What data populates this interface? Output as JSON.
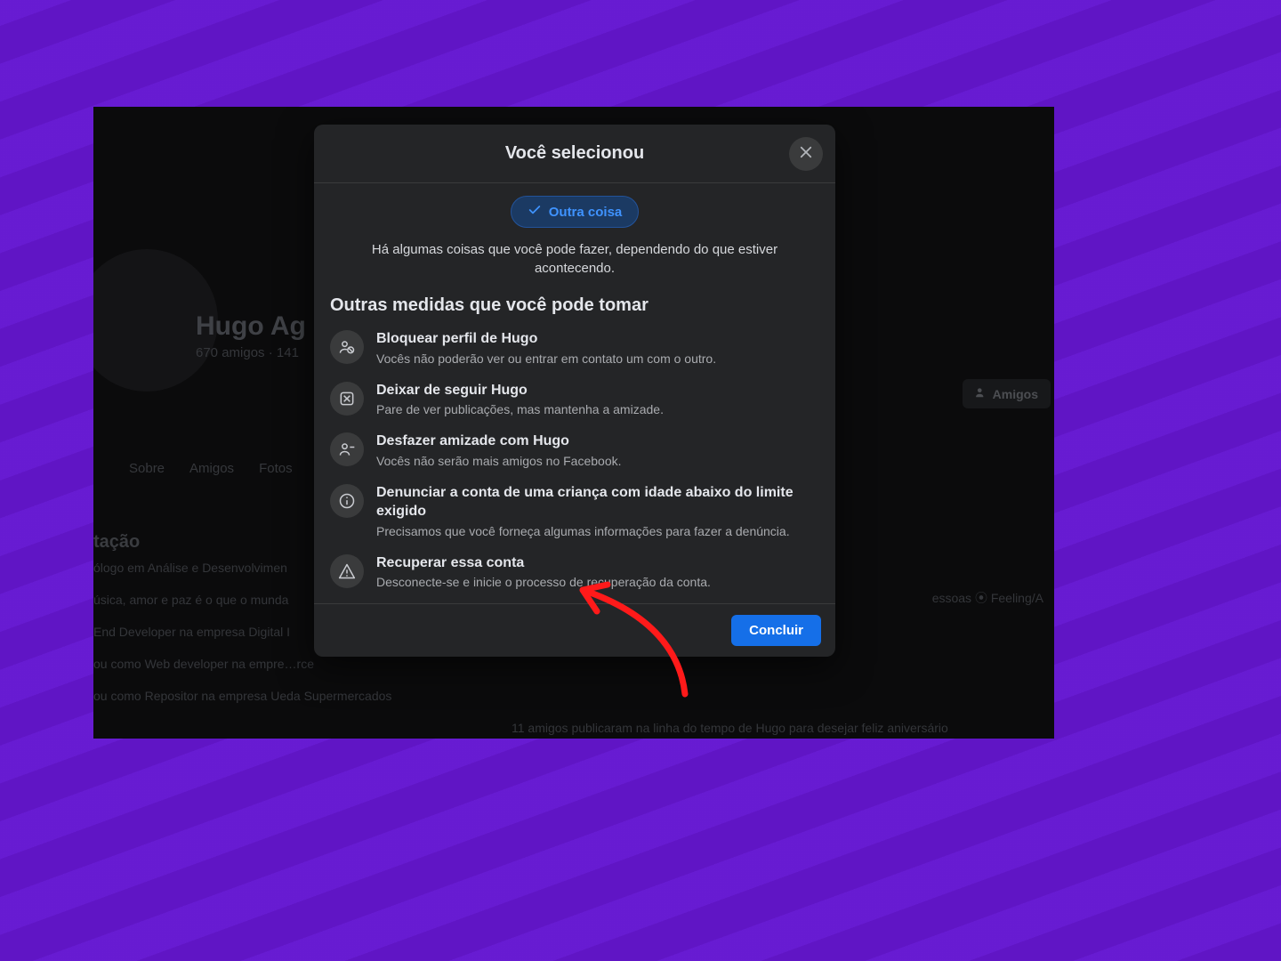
{
  "background_profile": {
    "name": "Hugo Ag",
    "friends_line": "670 amigos · 141",
    "tabs": [
      "Sobre",
      "Amigos",
      "Fotos"
    ],
    "intro_title": "tação",
    "intro_lines": [
      "ólogo em Análise e Desenvolvimen",
      "úsica, amor e paz é o que o munda",
      "End Developer na empresa Digital I",
      "ou como Web developer na empre…rce",
      "ou como Repositor na empresa Ueda Supermercados"
    ],
    "friends_button": "Amigos",
    "right_hint": "essoas    ⦿  Feeling/A",
    "timeline_hint": "11 amigos publicaram na linha do tempo de Hugo para desejar feliz aniversário"
  },
  "modal": {
    "title": "Você selecionou",
    "chip_label": "Outra coisa",
    "context_text": "Há algumas coisas que você pode fazer, dependendo do que estiver acontecendo.",
    "section_title": "Outras medidas que você pode tomar",
    "actions": [
      {
        "icon": "block-user",
        "title": "Bloquear perfil de Hugo",
        "desc": "Vocês não poderão ver ou entrar em contato um com o outro."
      },
      {
        "icon": "unfollow",
        "title": "Deixar de seguir Hugo",
        "desc": "Pare de ver publicações, mas mantenha a amizade."
      },
      {
        "icon": "remove-friend",
        "title": "Desfazer amizade com Hugo",
        "desc": "Vocês não serão mais amigos no Facebook."
      },
      {
        "icon": "info",
        "title": "Denunciar a conta de uma criança com idade abaixo do limite exigido",
        "desc": "Precisamos que você forneça algumas informações para fazer a denúncia."
      },
      {
        "icon": "warning",
        "title": "Recuperar essa conta",
        "desc": "Desconecte-se e inicie o processo de recuperação da conta."
      }
    ],
    "primary_button": "Concluir"
  }
}
